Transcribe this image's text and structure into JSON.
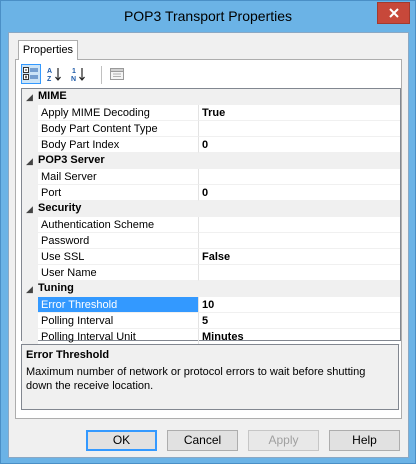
{
  "window": {
    "title": "POP3 Transport Properties"
  },
  "tabs": [
    {
      "label": "Properties"
    }
  ],
  "toolbar": {
    "buttons": [
      {
        "icon": "categorized-icon",
        "active": true
      },
      {
        "icon": "sort-alphabetical-icon"
      },
      {
        "icon": "sort-numeric-icon"
      },
      {
        "icon": "property-pages-icon"
      }
    ],
    "az_glyph_top": "A",
    "az_glyph_bottom": "Z",
    "num_glyph_top": "1",
    "num_glyph_bottom": "N"
  },
  "grid": {
    "categories": [
      {
        "name": "MIME",
        "properties": [
          {
            "name": "Apply MIME Decoding",
            "value": "True"
          },
          {
            "name": "Body Part Content Type",
            "value": ""
          },
          {
            "name": "Body Part Index",
            "value": "0"
          }
        ]
      },
      {
        "name": "POP3 Server",
        "properties": [
          {
            "name": "Mail Server",
            "value": ""
          },
          {
            "name": "Port",
            "value": "0"
          }
        ]
      },
      {
        "name": "Security",
        "properties": [
          {
            "name": "Authentication Scheme",
            "value": ""
          },
          {
            "name": "Password",
            "value": ""
          },
          {
            "name": "Use SSL",
            "value": "False"
          },
          {
            "name": "User Name",
            "value": ""
          }
        ]
      },
      {
        "name": "Tuning",
        "properties": [
          {
            "name": "Error Threshold",
            "value": "10",
            "selected": true
          },
          {
            "name": "Polling Interval",
            "value": "5"
          },
          {
            "name": "Polling Interval Unit",
            "value": "Minutes"
          }
        ]
      }
    ]
  },
  "description": {
    "title": "Error Threshold",
    "text": "Maximum number of network or protocol errors to wait before shutting down the receive location."
  },
  "buttons": {
    "ok": "OK",
    "cancel": "Cancel",
    "apply": "Apply",
    "help": "Help"
  }
}
